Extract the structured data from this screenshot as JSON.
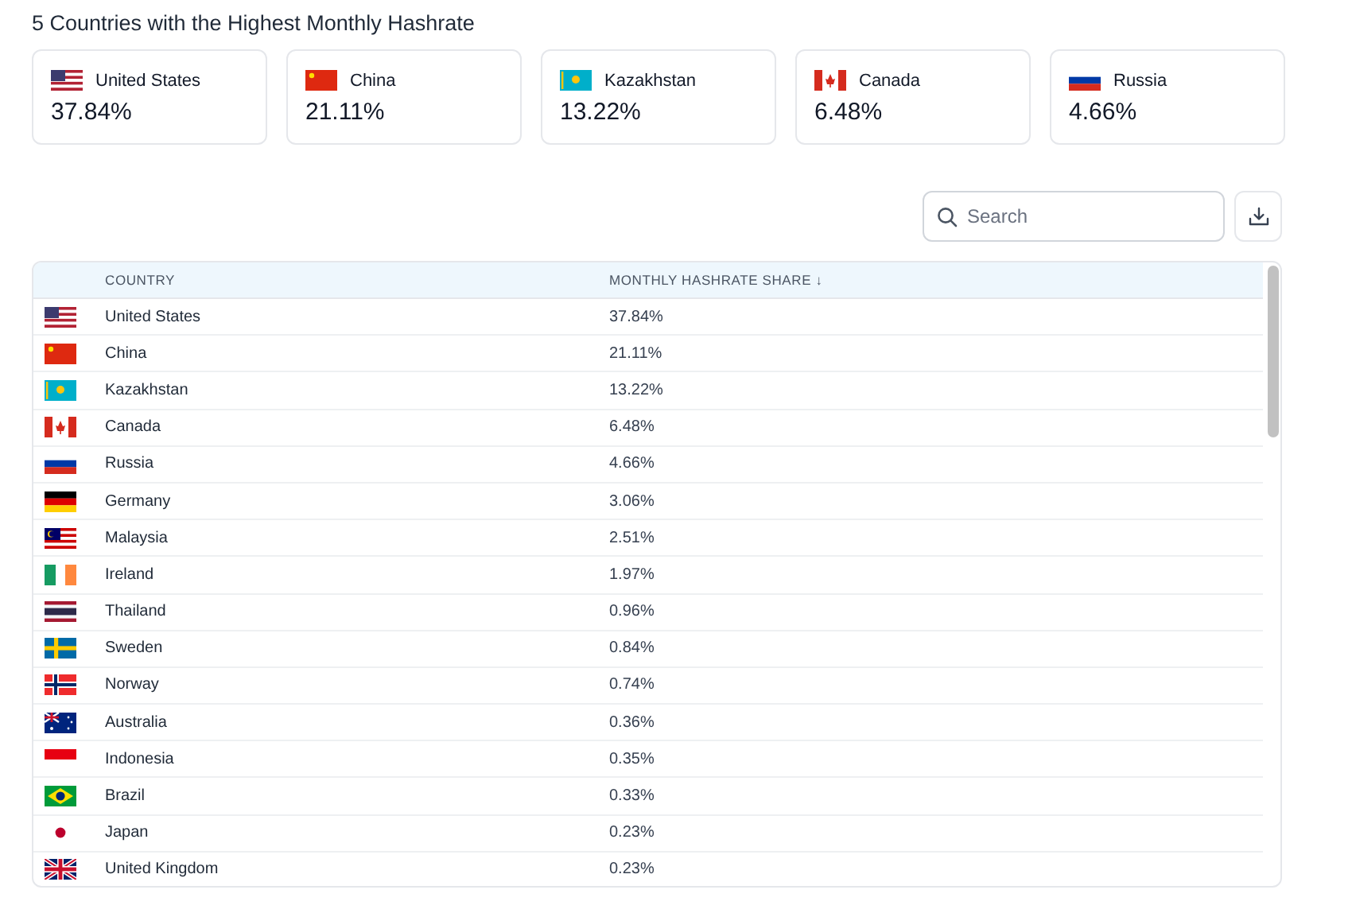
{
  "title": "5 Countries with the Highest Monthly Hashrate",
  "top_countries": [
    {
      "kind": "us",
      "name": "United States",
      "share": "37.84%"
    },
    {
      "kind": "cn",
      "name": "China",
      "share": "21.11%"
    },
    {
      "kind": "kz",
      "name": "Kazakhstan",
      "share": "13.22%"
    },
    {
      "kind": "ca",
      "name": "Canada",
      "share": "6.48%"
    },
    {
      "kind": "ru",
      "name": "Russia",
      "share": "4.66%"
    }
  ],
  "search": {
    "placeholder": "Search"
  },
  "table": {
    "columns": [
      "COUNTRY",
      "MONTHLY HASHRATE SHARE ↓"
    ],
    "rows": [
      {
        "kind": "us",
        "country": "United States",
        "share": "37.84%"
      },
      {
        "kind": "cn",
        "country": "China",
        "share": "21.11%"
      },
      {
        "kind": "kz",
        "country": "Kazakhstan",
        "share": "13.22%"
      },
      {
        "kind": "ca",
        "country": "Canada",
        "share": "6.48%"
      },
      {
        "kind": "ru",
        "country": "Russia",
        "share": "4.66%"
      },
      {
        "kind": "de",
        "country": "Germany",
        "share": "3.06%"
      },
      {
        "kind": "my",
        "country": "Malaysia",
        "share": "2.51%"
      },
      {
        "kind": "ie",
        "country": "Ireland",
        "share": "1.97%"
      },
      {
        "kind": "th",
        "country": "Thailand",
        "share": "0.96%"
      },
      {
        "kind": "se",
        "country": "Sweden",
        "share": "0.84%"
      },
      {
        "kind": "no",
        "country": "Norway",
        "share": "0.74%"
      },
      {
        "kind": "au",
        "country": "Australia",
        "share": "0.36%"
      },
      {
        "kind": "id",
        "country": "Indonesia",
        "share": "0.35%"
      },
      {
        "kind": "br",
        "country": "Brazil",
        "share": "0.33%"
      },
      {
        "kind": "jp",
        "country": "Japan",
        "share": "0.23%"
      },
      {
        "kind": "gb",
        "country": "United Kingdom",
        "share": "0.23%"
      }
    ]
  }
}
